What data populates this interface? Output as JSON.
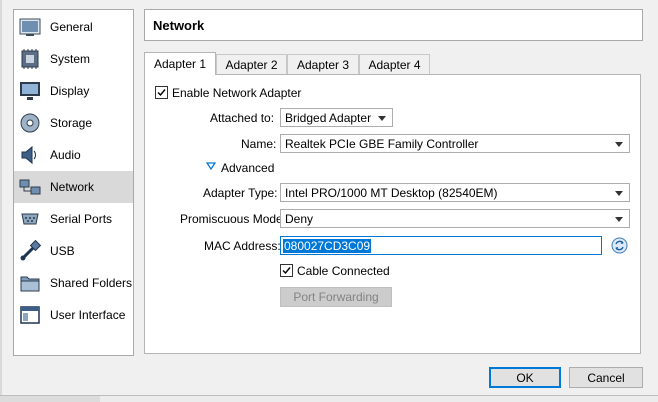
{
  "sidebar": {
    "items": [
      {
        "label": "General",
        "icon": "general-icon"
      },
      {
        "label": "System",
        "icon": "system-icon"
      },
      {
        "label": "Display",
        "icon": "display-icon"
      },
      {
        "label": "Storage",
        "icon": "storage-icon"
      },
      {
        "label": "Audio",
        "icon": "audio-icon"
      },
      {
        "label": "Network",
        "icon": "network-icon",
        "selected": true
      },
      {
        "label": "Serial Ports",
        "icon": "serial-ports-icon"
      },
      {
        "label": "USB",
        "icon": "usb-icon"
      },
      {
        "label": "Shared Folders",
        "icon": "shared-folders-icon"
      },
      {
        "label": "User Interface",
        "icon": "user-interface-icon"
      }
    ]
  },
  "page": {
    "title": "Network"
  },
  "tabs": [
    {
      "label": "Adapter 1",
      "active": true
    },
    {
      "label": "Adapter 2"
    },
    {
      "label": "Adapter 3"
    },
    {
      "label": "Adapter 4"
    }
  ],
  "adapter": {
    "enable_label": "Enable Network Adapter",
    "enable_checked": true,
    "attached_label": "Attached to:",
    "attached_value": "Bridged Adapter",
    "name_label": "Name:",
    "name_value": "Realtek PCIe GBE Family Controller",
    "advanced_label": "Advanced",
    "type_label": "Adapter Type:",
    "type_value": "Intel PRO/1000 MT Desktop (82540EM)",
    "promisc_label": "Promiscuous Mode:",
    "promisc_value": "Deny",
    "mac_label": "MAC Address:",
    "mac_value": "080027CD3C09",
    "cable_label": "Cable Connected",
    "cable_checked": true,
    "port_forwarding_label": "Port Forwarding"
  },
  "buttons": {
    "ok": "OK",
    "cancel": "Cancel"
  },
  "colors": {
    "accent": "#0078d7",
    "selected_row": "#d9d9d9"
  }
}
